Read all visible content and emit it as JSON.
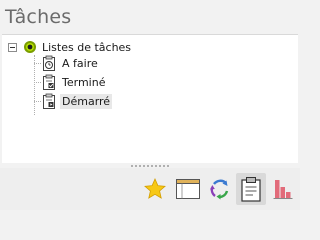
{
  "panel": {
    "title": "Tâches"
  },
  "tree": {
    "root": {
      "label": "Listes de tâches",
      "expanded": true,
      "icon": "bullet-circle-icon"
    },
    "children": [
      {
        "label": "A faire",
        "icon": "clipboard-clock-icon",
        "selected": false
      },
      {
        "label": "Terminé",
        "icon": "clipboard-check-icon",
        "selected": false
      },
      {
        "label": "Démarré",
        "icon": "clipboard-play-icon",
        "selected": true
      }
    ]
  },
  "toolbar": {
    "buttons": [
      {
        "icon": "star-icon",
        "active": false
      },
      {
        "icon": "window-icon",
        "active": false
      },
      {
        "icon": "sync-arrows-icon",
        "active": false
      },
      {
        "icon": "clipboard-icon",
        "active": true
      },
      {
        "icon": "bar-chart-icon",
        "active": false
      }
    ]
  },
  "colors": {
    "star": "#f5c518",
    "chart": "#e06070",
    "root_bullet_ring": "#8ab900",
    "active_button_bg": "#d9d9d9"
  }
}
